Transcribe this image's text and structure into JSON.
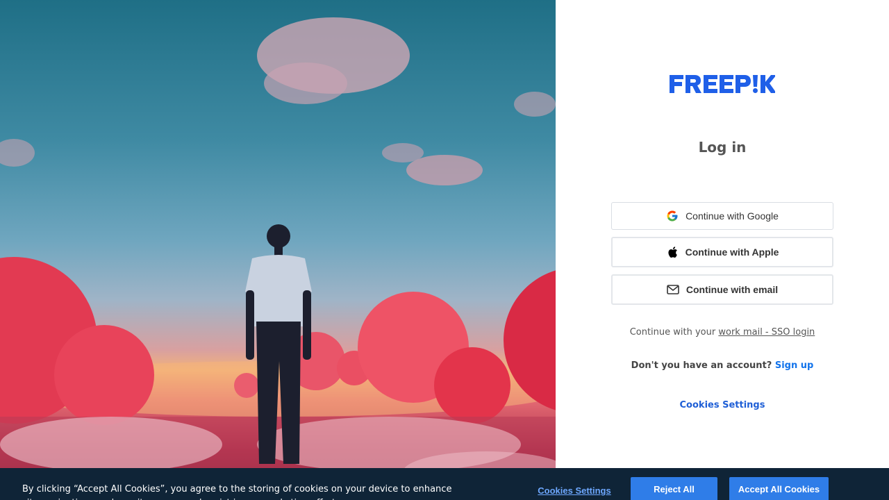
{
  "hero": {
    "alt": "person standing among red balloons at sunset"
  },
  "brand": {
    "name": "FREEPIK",
    "color": "#1273eb"
  },
  "login": {
    "title": "Log in",
    "google_label": "Continue with Google",
    "apple_label": "Continue with Apple",
    "email_label": "Continue with email",
    "sso_prefix": "Continue with your ",
    "sso_link": "work mail - SSO login",
    "signup_prefix": "Don't you have an account?",
    "signup_link": "Sign up",
    "cookies_link": "Cookies Settings"
  },
  "cookie_banner": {
    "text": "By clicking “Accept All Cookies”, you agree to the storing of cookies on your device to enhance site navigation, analyze site usage, and assist in our marketing efforts.",
    "settings_label": "Cookies Settings",
    "reject_label": "Reject All",
    "accept_label": "Accept All Cookies"
  },
  "icons": {
    "google": "google-icon",
    "apple": "apple-icon",
    "email": "mail-icon"
  }
}
